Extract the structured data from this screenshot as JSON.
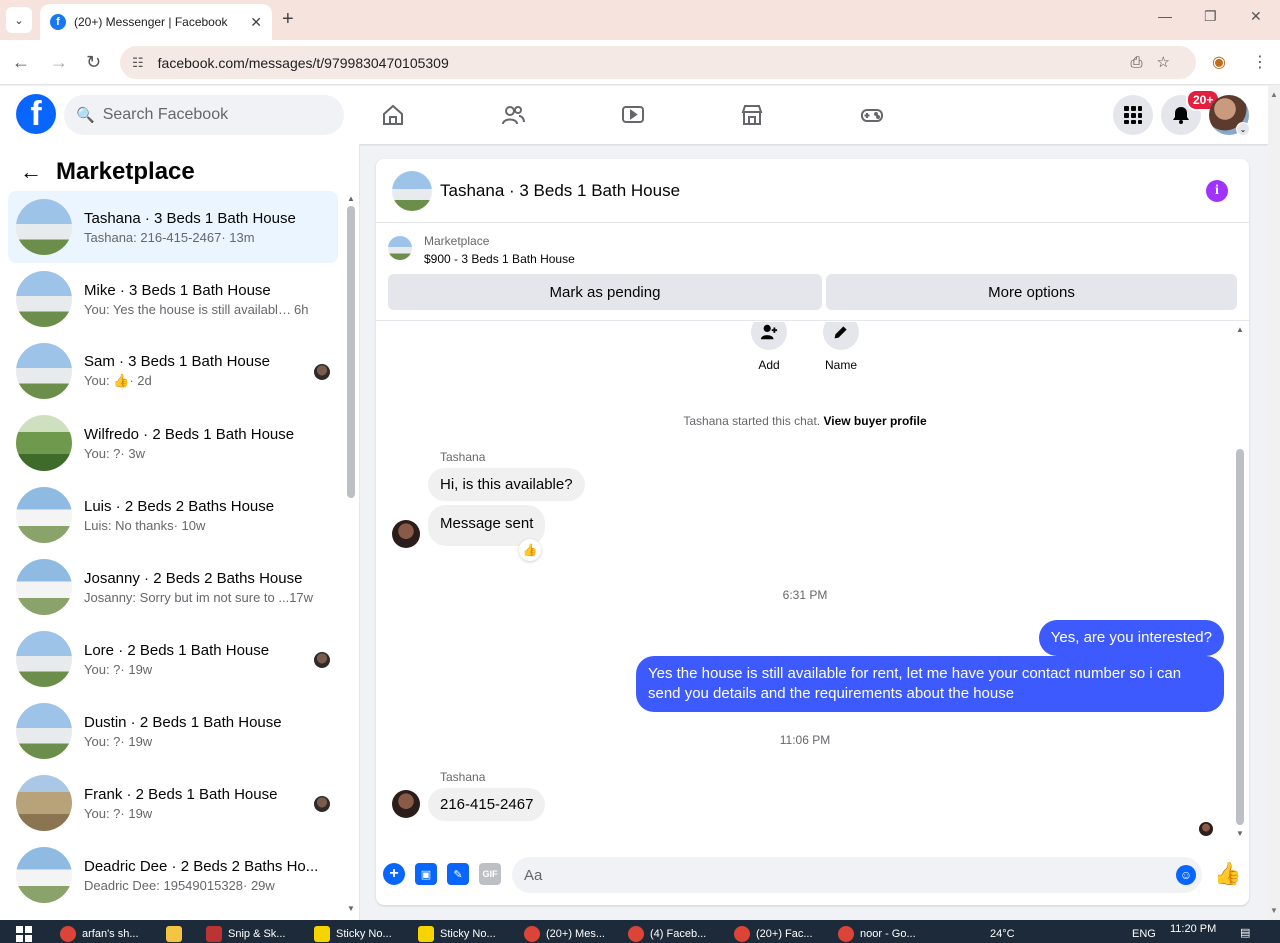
{
  "browser": {
    "tab_title": "(20+) Messenger | Facebook",
    "url": "facebook.com/messages/t/9799830470105309"
  },
  "header": {
    "search_placeholder": "Search Facebook",
    "notification_badge": "20+"
  },
  "sidebar": {
    "title": "Marketplace",
    "conversations": [
      {
        "name": "Tashana · 3 Beds 1 Bath House",
        "preview": "Tashana: 216-415-2467",
        "time": " · 13m",
        "active": true
      },
      {
        "name": "Mike · 3 Beds 1 Bath House",
        "preview": "You: Yes the house is still available f...",
        "time": " 6h"
      },
      {
        "name": "Sam · 3 Beds 1 Bath House",
        "preview": "You: 👍",
        "time": " · 2d"
      },
      {
        "name": "Wilfredo · 2 Beds 1 Bath House",
        "preview": "You: ?",
        "time": " · 3w"
      },
      {
        "name": "Luis · 2 Beds 2 Baths House",
        "preview": "Luis: No thanks",
        "time": " · 10w"
      },
      {
        "name": "Josanny · 2 Beds 2 Baths House",
        "preview": "Josanny: Sorry but im not sure to ...",
        "time": " 17w"
      },
      {
        "name": "Lore · 2 Beds 1 Bath House",
        "preview": "You: ?",
        "time": " · 19w"
      },
      {
        "name": "Dustin · 2 Beds 1 Bath House",
        "preview": "You: ?",
        "time": " · 19w"
      },
      {
        "name": "Frank · 2 Beds 1 Bath House",
        "preview": "You: ?",
        "time": " · 19w"
      },
      {
        "name": "Deadric Dee · 2 Beds 2 Baths Ho...",
        "preview": "Deadric Dee: 19549015328",
        "time": " · 29w"
      }
    ]
  },
  "chat": {
    "title": "Tashana · 3 Beds 1 Bath House",
    "listing_category": "Marketplace",
    "listing_desc": "$900 - 3 Beds 1 Bath House",
    "btn_pending": "Mark as pending",
    "btn_more": "More options",
    "action_add": "Add",
    "action_name": "Name",
    "started_text": "Tashana started this chat.",
    "view_profile": "View buyer profile",
    "sender_name": "Tashana",
    "msg1": "Hi, is this available?",
    "msg2": "Message sent",
    "time1": "6:31 PM",
    "out1": "Yes, are you interested?",
    "out2": "Yes the house is still available for rent, let me have your contact number so i can send you details and the requirements about the house",
    "time2": "11:06 PM",
    "sender_name2": "Tashana",
    "msg3": "216-415-2467",
    "composer_placeholder": "Aa"
  },
  "taskbar": {
    "items": [
      "arfan's sh...",
      "Snip & Sk...",
      "Sticky No...",
      "Sticky No...",
      "(20+) Mes...",
      "(4) Faceb...",
      "(20+) Fac...",
      "noor - Go..."
    ],
    "temp": "24°C",
    "lang": "ENG",
    "time": "11:20 PM"
  },
  "colors": {
    "brand": "#0866ff",
    "outgoing_bubble": "#3d5afe",
    "badge": "#e41e3f"
  }
}
